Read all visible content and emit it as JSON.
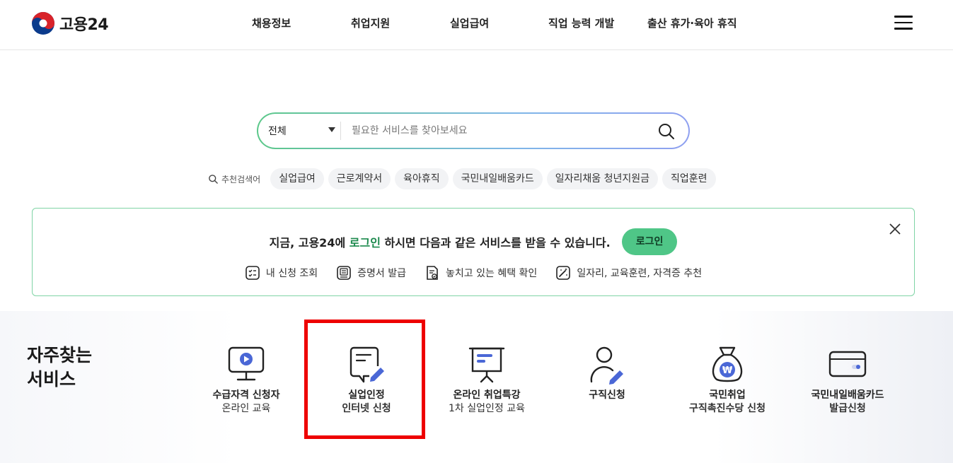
{
  "logo": {
    "text": "고용24"
  },
  "nav": [
    {
      "label": "채용정보"
    },
    {
      "label": "취업지원"
    },
    {
      "label": "실업급여"
    },
    {
      "label": "직업 능력 개발"
    },
    {
      "label": "출산 휴가·육아 휴직"
    }
  ],
  "search": {
    "category": "전체",
    "placeholder": "필요한 서비스를 찾아보세요"
  },
  "recommended": {
    "label": "추천검색어",
    "keywords": [
      "실업급여",
      "근로계약서",
      "육아휴직",
      "국민내일배움카드",
      "일자리채움 청년지원금",
      "직업훈련"
    ]
  },
  "banner": {
    "prefix": "지금, 고용24에 ",
    "login_word": "로그인",
    "suffix": " 하시면 다음과 같은 서비스를 받을 수 있습니다.",
    "login_button": "로그인",
    "links": [
      {
        "label": "내 신청 조회",
        "icon": "checklist-icon"
      },
      {
        "label": "증명서 발급",
        "icon": "certificate-icon"
      },
      {
        "label": "놓치고 있는 혜택 확인",
        "icon": "benefit-check-icon"
      },
      {
        "label": "일자리, 교육훈련, 자격증 추천",
        "icon": "magic-wand-icon"
      }
    ]
  },
  "services": {
    "title_line1": "자주찾는",
    "title_line2": "서비스",
    "items": [
      {
        "line1": "수급자격 신청자",
        "line2": "온라인 교육",
        "icon": "monitor-play-icon"
      },
      {
        "line1": "실업인정",
        "line2": "인터넷 신청",
        "icon": "document-pen-icon"
      },
      {
        "line1": "온라인 취업특강",
        "line2": "1차 실업인정 교육",
        "icon": "presentation-board-icon"
      },
      {
        "line1": "구직신청",
        "line2": "",
        "icon": "person-pen-icon"
      },
      {
        "line1": "국민취업",
        "line2": "구직촉진수당 신청",
        "icon": "money-bag-icon"
      },
      {
        "line1": "국민내일배움카드",
        "line2": "발급신청",
        "icon": "card-icon"
      }
    ]
  },
  "colors": {
    "accent_green": "#4fc687",
    "search_gradient_start": "#5cc88a",
    "search_gradient_end": "#8fa0f0",
    "icon_blue": "#4a67d6",
    "highlight_red": "#ee0000"
  }
}
